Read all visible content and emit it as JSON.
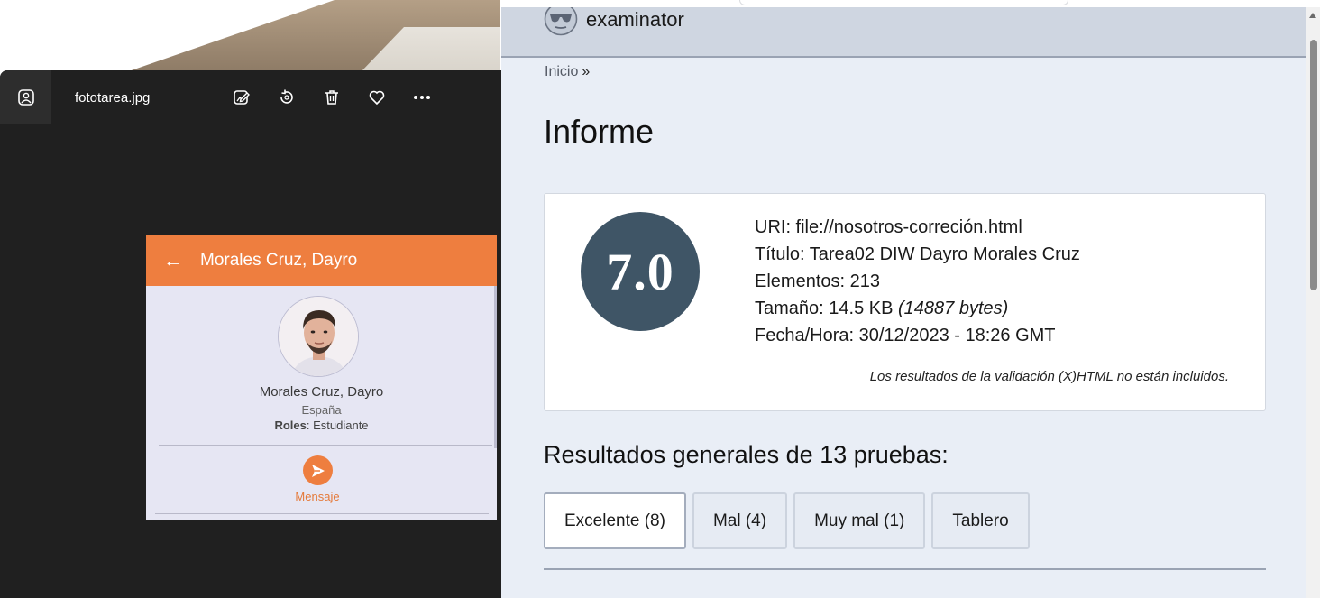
{
  "viewer": {
    "filename": "fototarea.jpg",
    "tools": [
      {
        "icon": "edit-image-icon"
      },
      {
        "icon": "rotate-icon"
      },
      {
        "icon": "delete-icon"
      },
      {
        "icon": "favorite-icon"
      },
      {
        "icon": "more-icon"
      }
    ],
    "photo": {
      "header_title": "Morales Cruz, Dayro",
      "name": "Morales Cruz, Dayro",
      "country": "España",
      "roles_label": "Roles",
      "roles_value": ": Estudiante",
      "message_label": "Mensaje",
      "accent_color": "#ee7e3f"
    }
  },
  "page": {
    "brand": "examinator",
    "breadcrumb": {
      "home": "Inicio",
      "separator": "»"
    },
    "title": "Informe",
    "report": {
      "score": "7.0",
      "uri": "URI: file://nosotros-correción.html",
      "title_line": "Título: Tarea02 DIW Dayro Morales Cruz",
      "elements": "Elementos: 213",
      "size_prefix": "Tamaño: 14.5 KB ",
      "size_bytes": "(14887 bytes)",
      "datetime": "Fecha/Hora: 30/12/2023 - 18:26 GMT",
      "note": "Los resultados de la validación (X)HTML no están incluidos."
    },
    "results_heading": "Resultados generales de 13 pruebas:",
    "tabs": [
      {
        "label": "Excelente (8)",
        "active": true
      },
      {
        "label": "Mal (4)",
        "active": false
      },
      {
        "label": "Muy mal (1)",
        "active": false
      },
      {
        "label": "Tablero",
        "active": false
      }
    ]
  }
}
